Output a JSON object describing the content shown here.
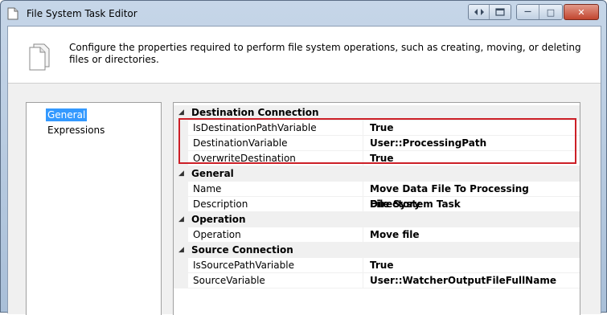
{
  "window": {
    "title": "File System Task Editor",
    "close_glyph": "✕",
    "minimize_glyph": "—",
    "maximize_glyph": "□"
  },
  "header": {
    "description": "Configure the properties required to perform file system operations, such as creating, moving, or deleting files or directories."
  },
  "nav": {
    "items": [
      {
        "label": "General",
        "selected": true
      },
      {
        "label": "Expressions",
        "selected": false
      }
    ]
  },
  "properties": {
    "categories": [
      {
        "label": "Destination Connection",
        "rows": [
          {
            "name": "IsDestinationPathVariable",
            "value": "True"
          },
          {
            "name": "DestinationVariable",
            "value": "User::ProcessingPath"
          },
          {
            "name": "OverwriteDestination",
            "value": "True"
          }
        ]
      },
      {
        "label": "General",
        "rows": [
          {
            "name": "Name",
            "value": "Move Data File To Processing Directory"
          },
          {
            "name": "Description",
            "value": "File System Task"
          }
        ]
      },
      {
        "label": "Operation",
        "rows": [
          {
            "name": "Operation",
            "value": "Move file"
          }
        ]
      },
      {
        "label": "Source Connection",
        "rows": [
          {
            "name": "IsSourcePathVariable",
            "value": "True"
          },
          {
            "name": "SourceVariable",
            "value": "User::WatcherOutputFileFullName"
          }
        ]
      }
    ]
  },
  "colors": {
    "highlight_box": "#cc1f27",
    "selection": "#3399ff"
  }
}
